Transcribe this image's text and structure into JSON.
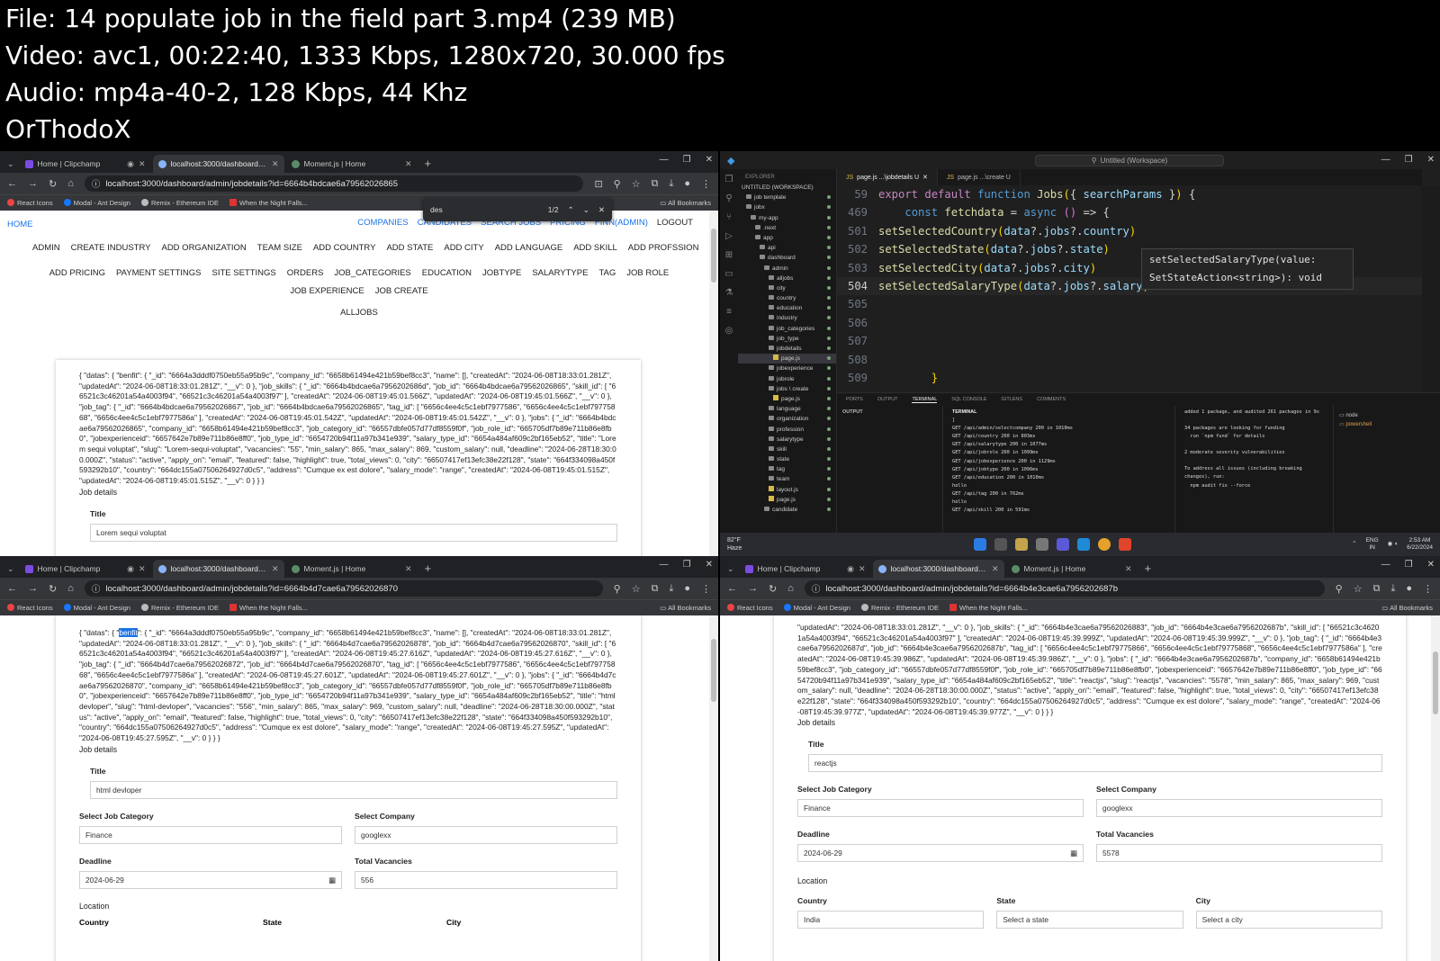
{
  "header": {
    "lines": [
      "File: 14  populate job in the field part 3.mp4 (239 MB)",
      "Video: avc1, 00:22:40, 1333 Kbps, 1280x720, 30.000 fps",
      "Audio: mp4a-40-2, 128 Kbps, 44 Khz",
      "OrThodoX"
    ]
  },
  "browser": {
    "tabs": [
      "Home | Clipchamp",
      "localhost:3000/dashboard/admin/",
      "Moment.js | Home"
    ],
    "bookmarks": [
      "React Icons",
      "Modal - Ant Design",
      "Remix - Ethereum IDE",
      "When the Night Falls..."
    ],
    "all_bookmarks": "All Bookmarks"
  },
  "app": {
    "home": "HOME",
    "right_nav": [
      "COMPANIES",
      "CANDIDATES",
      "SEARCH JOBS",
      "PRICING",
      "FINN(ADMIN)",
      "LOGOUT"
    ],
    "admin_nav_row1": [
      "ADMIN",
      "CREATE INDUSTRY",
      "ADD ORGANIZATION",
      "TEAM SIZE",
      "ADD COUNTRY",
      "ADD STATE",
      "ADD CITY",
      "ADD LANGUAGE",
      "ADD SKILL",
      "ADD PROFSSION"
    ],
    "admin_nav_row2": [
      "ADD PRICING",
      "PAYMENT SETTINGS",
      "SITE SETTINGS",
      "ORDERS",
      "JOB_CATEGORIES",
      "EDUCATION",
      "JOBTYPE",
      "SALARYTYPE",
      "TAG",
      "JOB ROLE"
    ],
    "admin_nav_row3": [
      "JOB EXPERIENCE",
      "JOB CREATE"
    ],
    "alljobs": "ALLJOBS",
    "job_details_label": "Job details",
    "labels": {
      "title": "Title",
      "job_category": "Select Job Category",
      "company": "Select Company",
      "deadline": "Deadline",
      "vacancies": "Total Vacancies",
      "location": "Location",
      "country": "Country",
      "state": "State",
      "city": "City"
    }
  },
  "panel_tl": {
    "url": "localhost:3000/dashboard/admin/jobdetails?id=6664b4bdcae6a79562026865",
    "find": {
      "query": "des",
      "count": "1/2"
    },
    "json_text": "{ \"datas\": { \"benfit\": { \"_id\": \"6664a3dddf0750eb55a95b9c\", \"company_id\": \"6658b61494e421b59bef8cc3\", \"name\": [], \"createdAt\": \"2024-06-08T18:33:01.281Z\", \"updatedAt\": \"2024-06-08T18:33:01.281Z\", \"__v\": 0 }, \"job_skills\": { \"_id\": \"6664b4bdcae6a7956202686d\", \"job_id\": \"6664b4bdcae6a79562026865\", \"skill_id\": [ \"66521c3c46201a54a4003f94\", \"66521c3c46201a54a4003f97\" ], \"createdAt\": \"2024-06-08T19:45:01.566Z\", \"updatedAt\": \"2024-06-08T19:45:01.566Z\", \"__v\": 0 }, \"job_tag\": { \"_id\": \"6664b4bdcae6a79562026867\", \"job_id\": \"6664b4bdcae6a79562026865\", \"tag_id\": [ \"6656c4ee4c5c1ebf7977586\", \"6656c4ee4c5c1ebf79775868\", \"6656c4ee4c5c1ebf7977586a\" ], \"createdAt\": \"2024-06-08T19:45:01.542Z\", \"updatedAt\": \"2024-06-08T19:45:01.542Z\", \"__v\": 0 }, \"jobs\": { \"_id\": \"6664b4bdcae6a79562026865\", \"company_id\": \"6658b61494e421b59bef8cc3\", \"job_category_id\": \"66557dbfe057d77df8559f0f\", \"job_role_id\": \"665705df7b89e711b86e8fb0\", \"jobexperienceid\": \"6657642e7b89e711b86e8ff0\", \"job_type_id\": \"6654720b94f11a97b341e939\", \"salary_type_id\": \"6654a484af609c2bf165eb52\", \"title\": \"Lorem sequi voluptat\", \"slug\": \"Lorem-sequi-voluptat\", \"vacancies\": \"55\", \"min_salary\": 865, \"max_salary\": 869, \"custom_salary\": null, \"deadline\": \"2024-06-28T18:30:00.000Z\", \"status\": \"active\", \"apply_on\": \"email\", \"featured\": false, \"highlight\": true, \"total_views\": 0, \"city\": \"66507417ef13efc38e22f128\", \"state\": \"664f334098a450f593292b10\", \"country\": \"664dc155a07506264927d0c5\", \"address\": \"Cumque ex est dolore\", \"salary_mode\": \"range\", \"createdAt\": \"2024-06-08T19:45:01.515Z\", \"updatedAt\": \"2024-06-08T19:45:01.515Z\", \"__v\": 0 } } }",
    "title_value": "Lorem sequi voluptat"
  },
  "panel_bl": {
    "url": "localhost:3000/dashboard/admin/jobdetails?id=6664b4d7cae6a79562026870",
    "json_prefix": "{ \"datas\": { \"",
    "json_highlight": "benfit",
    "json_rest": "\": { \"_id\": \"6664a3dddf0750eb55a95b9c\", \"company_id\": \"6658b61494e421b59bef8cc3\", \"name\": [], \"createdAt\": \"2024-06-08T18:33:01.281Z\", \"updatedAt\": \"2024-06-08T18:33:01.281Z\", \"__v\": 0 }, \"job_skills\": { \"_id\": \"6664b4d7cae6a79562026878\", \"job_id\": \"6664b4d7cae6a79562026870\", \"skill_id\": [ \"66521c3c46201a54a4003f94\", \"66521c3c46201a54a4003f97\" ], \"createdAt\": \"2024-06-08T19:45:27.616Z\", \"updatedAt\": \"2024-06-08T19:45:27.616Z\", \"__v\": 0 }, \"job_tag\": { \"_id\": \"6664b4d7cae6a79562026872\", \"job_id\": \"6664b4d7cae6a79562026870\", \"tag_id\": [ \"6656c4ee4c5c1ebf7977586\", \"6656c4ee4c5c1ebf79775868\", \"6656c4ee4c5c1ebf7977586a\" ], \"createdAt\": \"2024-06-08T19:45:27.601Z\", \"updatedAt\": \"2024-06-08T19:45:27.601Z\", \"__v\": 0 }, \"jobs\": { \"_id\": \"6664b4d7cae6a79562026870\", \"company_id\": \"6658b61494e421b59bef8cc3\", \"job_category_id\": \"66557dbfe057d77df8559f0f\", \"job_role_id\": \"665705df7b89e711b86e8fb0\", \"jobexperienceid\": \"6657642e7b89e711b86e8ff0\", \"job_type_id\": \"6654720b94f11a97b341e939\", \"salary_type_id\": \"6654a484af609c2bf165eb52\", \"title\": \"html devloper\", \"slug\": \"html-devloper\", \"vacancies\": \"556\", \"min_salary\": 865, \"max_salary\": 969, \"custom_salary\": null, \"deadline\": \"2024-06-28T18:30:00.000Z\", \"status\": \"active\", \"apply_on\": \"email\", \"featured\": false, \"highlight\": true, \"total_views\": 0, \"city\": \"66507417ef13efc38e22f128\", \"state\": \"664f334098a450f593292b10\", \"country\": \"664dc155a07506264927d0c5\", \"address\": \"Cumque ex est dolore\", \"salary_mode\": \"range\", \"createdAt\": \"2024-06-08T19:45:27.595Z\", \"updatedAt\": \"2024-06-08T19:45:27.595Z\", \"__v\": 0 } } }",
    "title_value": "html devloper",
    "category_value": "Finance",
    "company_value": "googlexx",
    "deadline_value": "2024-06-29",
    "vacancies_value": "556"
  },
  "panel_br": {
    "url": "localhost:3000/dashboard/admin/jobdetails?id=6664b4e3cae6a7956202687b",
    "json_text": "\"updatedAt\": \"2024-06-08T18:33:01.281Z\", \"__v\": 0 }, \"job_skills\": { \"_id\": \"6664b4e3cae6a79562026883\", \"job_id\": \"6664b4e3cae6a7956202687b\", \"skill_id\": [ \"66521c3c46201a54a4003f94\", \"66521c3c46201a54a4003f97\" ], \"createdAt\": \"2024-06-08T19:45:39.999Z\", \"updatedAt\": \"2024-06-08T19:45:39.999Z\", \"__v\": 0 }, \"job_tag\": { \"_id\": \"6664b4e3cae6a7956202687d\", \"job_id\": \"6664b4e3cae6a7956202687b\", \"tag_id\": [ \"6656c4ee4c5c1ebf79775866\", \"6656c4ee4c5c1ebf79775868\", \"6656c4ee4c5c1ebf7977586a\" ], \"createdAt\": \"2024-06-08T19:45:39.986Z\", \"updatedAt\": \"2024-06-08T19:45:39.986Z\", \"__v\": 0 }, \"jobs\": { \"_id\": \"6664b4e3cae6a7956202687b\", \"company_id\": \"6658b61494e421b59bef8cc3\", \"job_category_id\": \"66557dbfe057d77df8559f0f\", \"job_role_id\": \"665705df7b89e711b86e8fb0\", \"jobexperienceid\": \"6657642e7b89e711b86e8ff0\", \"job_type_id\": \"6654720b94f11a97b341e939\", \"salary_type_id\": \"6654a484af609c2bf165eb52\", \"title\": \"reactjs\", \"slug\": \"reactjs\", \"vacancies\": \"5578\", \"min_salary\": 865, \"max_salary\": 969, \"custom_salary\": null, \"deadline\": \"2024-06-28T18:30:00.000Z\", \"status\": \"active\", \"apply_on\": \"email\", \"featured\": false, \"highlight\": true, \"total_views\": 0, \"city\": \"66507417ef13efc38e22f128\", \"state\": \"664f334098a450f593292b10\", \"country\": \"664dc155a07506264927d0c5\", \"address\": \"Cumque ex est dolore\", \"salary_mode\": \"range\", \"createdAt\": \"2024-06-08T19:45:39.977Z\", \"updatedAt\": \"2024-06-08T19:45:39.977Z\", \"__v\": 0 } } }",
    "title_value": "reactjs",
    "category_value": "Finance",
    "company_value": "googlexx",
    "deadline_value": "2024-06-29",
    "vacancies_value": "5578",
    "country_value": "India",
    "state_placeholder": "Select a state",
    "city_placeholder": "Select a city"
  },
  "vscode": {
    "search_title": "Untitled (Workspace)",
    "explorer_title": "EXPLORER",
    "tree": [
      {
        "label": "UNTITLED (WORKSPACE)",
        "depth": 0,
        "type": "head"
      },
      {
        "label": "job template",
        "depth": 1,
        "type": "folder"
      },
      {
        "label": "jobx",
        "depth": 1,
        "type": "folder"
      },
      {
        "label": "my-app",
        "depth": 2,
        "type": "folder"
      },
      {
        "label": ".next",
        "depth": 3,
        "type": "folder"
      },
      {
        "label": "app",
        "depth": 3,
        "type": "folder"
      },
      {
        "label": "api",
        "depth": 4,
        "type": "folder"
      },
      {
        "label": "dashboard",
        "depth": 4,
        "type": "folder"
      },
      {
        "label": "admin",
        "depth": 5,
        "type": "folder"
      },
      {
        "label": "alljobs",
        "depth": 6,
        "type": "folder"
      },
      {
        "label": "city",
        "depth": 6,
        "type": "folder"
      },
      {
        "label": "country",
        "depth": 6,
        "type": "folder"
      },
      {
        "label": "education",
        "depth": 6,
        "type": "folder"
      },
      {
        "label": "industry",
        "depth": 6,
        "type": "folder"
      },
      {
        "label": "job_categories",
        "depth": 6,
        "type": "folder"
      },
      {
        "label": "job_type",
        "depth": 6,
        "type": "folder"
      },
      {
        "label": "jobdetails",
        "depth": 6,
        "type": "folder"
      },
      {
        "label": "page.js",
        "depth": 7,
        "type": "file",
        "selected": true
      },
      {
        "label": "jobexperience",
        "depth": 6,
        "type": "folder"
      },
      {
        "label": "jobrole",
        "depth": 6,
        "type": "folder"
      },
      {
        "label": "jobs \\ create",
        "depth": 6,
        "type": "folder"
      },
      {
        "label": "page.js",
        "depth": 7,
        "type": "file"
      },
      {
        "label": "language",
        "depth": 6,
        "type": "folder"
      },
      {
        "label": "organization",
        "depth": 6,
        "type": "folder"
      },
      {
        "label": "profession",
        "depth": 6,
        "type": "folder"
      },
      {
        "label": "salarytype",
        "depth": 6,
        "type": "folder"
      },
      {
        "label": "skill",
        "depth": 6,
        "type": "folder"
      },
      {
        "label": "state",
        "depth": 6,
        "type": "folder"
      },
      {
        "label": "tag",
        "depth": 6,
        "type": "folder"
      },
      {
        "label": "team",
        "depth": 6,
        "type": "folder"
      },
      {
        "label": "layout.js",
        "depth": 6,
        "type": "file"
      },
      {
        "label": "page.js",
        "depth": 6,
        "type": "file"
      },
      {
        "label": "candidate",
        "depth": 5,
        "type": "folder"
      }
    ],
    "editor_tabs": [
      "page.js ...\\jobdetails U",
      "page.js ...\\create U"
    ],
    "code_lines": [
      {
        "n": "59",
        "tokens": [
          [
            "kw",
            "export "
          ],
          [
            "kw",
            "default "
          ],
          [
            "kwb",
            "function "
          ],
          [
            "fn",
            "Jobs"
          ],
          [
            "br",
            "("
          ],
          [
            "pu",
            "{ "
          ],
          [
            "pr",
            "searchParams"
          ],
          [
            "pu",
            " }"
          ],
          [
            "br",
            ")"
          ],
          [
            "pu",
            " {"
          ]
        ]
      },
      {
        "n": "469",
        "tokens": [
          [
            "pu",
            "    "
          ],
          [
            "kwb",
            "const "
          ],
          [
            "fn",
            "fetchdata"
          ],
          [
            "pu",
            " = "
          ],
          [
            "kwb",
            "async "
          ],
          [
            "br2",
            "("
          ],
          [
            "br2",
            ")"
          ],
          [
            "pu",
            " => {"
          ]
        ]
      },
      {
        "n": "501",
        "tokens": [
          [
            "fn",
            "setSelectedCountry"
          ],
          [
            "br",
            "("
          ],
          [
            "pr",
            "data"
          ],
          [
            "pu",
            "?."
          ],
          [
            "pr",
            "jobs"
          ],
          [
            "pu",
            "?."
          ],
          [
            "pr",
            "country"
          ],
          [
            "br",
            ")"
          ]
        ]
      },
      {
        "n": "502",
        "tokens": [
          [
            "fn",
            "setSelectedState"
          ],
          [
            "br",
            "("
          ],
          [
            "pr",
            "data"
          ],
          [
            "pu",
            "?."
          ],
          [
            "pr",
            "jobs"
          ],
          [
            "pu",
            "?."
          ],
          [
            "pr",
            "state"
          ],
          [
            "br",
            ")"
          ]
        ]
      },
      {
        "n": "503",
        "tokens": [
          [
            "fn",
            "setSelectedCity"
          ],
          [
            "br",
            "("
          ],
          [
            "pr",
            "data"
          ],
          [
            "pu",
            "?."
          ],
          [
            "pr",
            "jobs"
          ],
          [
            "pu",
            "?."
          ],
          [
            "pr",
            "city"
          ],
          [
            "br",
            ")"
          ]
        ]
      },
      {
        "n": "504",
        "current": true,
        "tokens": [
          [
            "fn",
            "setSelectedSalaryType"
          ],
          [
            "br",
            "("
          ],
          [
            "pr",
            "data"
          ],
          [
            "pu",
            "?."
          ],
          [
            "pr",
            "jobs"
          ],
          [
            "pu",
            "?."
          ],
          [
            "pr",
            "salary"
          ],
          [
            "br",
            ")"
          ]
        ]
      },
      {
        "n": "505",
        "tokens": []
      },
      {
        "n": "506",
        "tokens": []
      },
      {
        "n": "507",
        "tokens": []
      },
      {
        "n": "508",
        "tokens": []
      },
      {
        "n": "509",
        "tokens": [
          [
            "pu",
            "        "
          ],
          [
            "br",
            "}"
          ]
        ]
      }
    ],
    "hover_lines": [
      "setSelectedSalaryType(value:",
      "SetStateAction<string>): void"
    ],
    "panel_tabs": [
      "PORTS",
      "OUTPUT",
      "TERMINAL",
      "SQL CONSOLE",
      "GITLENS",
      "COMMENTS"
    ],
    "output_label": "OUTPUT",
    "terminal_label": "TERMINAL",
    "terminal_lines": [
      "]",
      "GET /api/admin/selectcompany 200 in 1010ms",
      "GET /api/country 200 in 803ms",
      "GET /api/salarytype 200 in 1077ms",
      "GET /api/jobrole 200 in 1099ms",
      "GET /api/jobexperience 200 in 1129ms",
      "GET /api/jobtype 200 in 1096ms",
      "GET /api/education 200 in 1010ms",
      "hello",
      "GET /api/tag 200 in 762ms",
      "hello",
      "GET /api/skill 200 in 591ms"
    ],
    "terminal2_lines": [
      "added 1 package, and audited 261 packages in 9s",
      "",
      "34 packages are looking for funding",
      "  run `npm fund` for details",
      "",
      "2 moderate severity vulnerabilities",
      "",
      "To address all issues (including breaking changes), run:",
      "  npm audit fix --force"
    ],
    "terminal_list": [
      "node",
      "powershell"
    ],
    "taskbar": {
      "weather_temp": "82°F",
      "weather_desc": "Haze",
      "lang": "ENG",
      "region": "IN",
      "time": "2:53 AM",
      "date": "6/22/2024"
    }
  },
  "colors": {
    "link": "#1a73e8",
    "browser_dark": "#202124",
    "vscode_bg": "#1f1f1f",
    "selection": "#1a73e8"
  }
}
